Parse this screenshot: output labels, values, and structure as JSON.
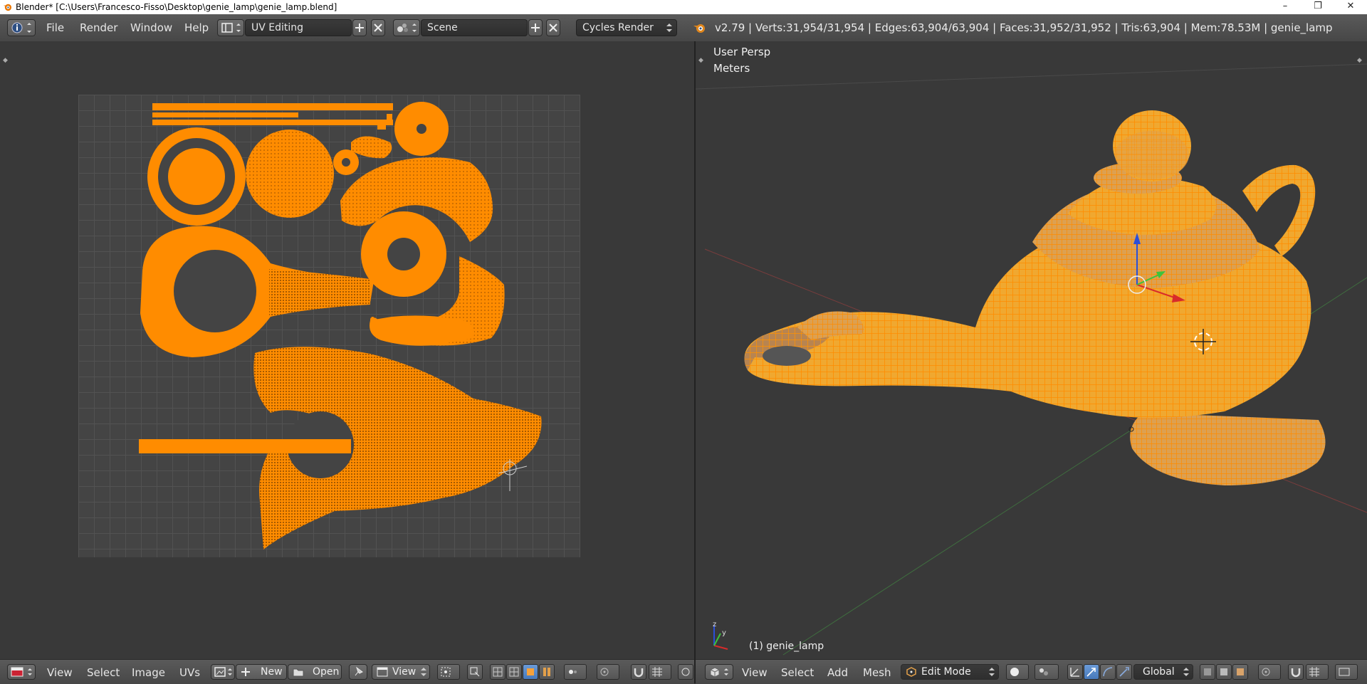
{
  "window": {
    "title": "Blender* [C:\\Users\\Francesco-Fisso\\Desktop\\genie_lamp\\genie_lamp.blend]",
    "min_glyph": "–",
    "restore_glyph": "❐",
    "close_glyph": "✕"
  },
  "infobar": {
    "menus": [
      "File",
      "Render",
      "Window",
      "Help"
    ],
    "screen_layout": "UV Editing",
    "scene": "Scene",
    "render_engine": "Cycles Render",
    "stats": "v2.79 | Verts:31,954/31,954 | Edges:63,904/63,904 | Faces:31,952/31,952 | Tris:63,904 | Mem:78.53M | genie_lamp"
  },
  "viewport": {
    "view_name": "User Persp",
    "units": "Meters",
    "object_label": "(1) genie_lamp"
  },
  "uv_footer": {
    "menus": [
      "View",
      "Select",
      "Image",
      "UVs"
    ],
    "new_label": "New",
    "open_label": "Open",
    "view_label": "View"
  },
  "view3d_footer": {
    "menus": [
      "View",
      "Select",
      "Add",
      "Mesh"
    ],
    "mode": "Edit Mode",
    "orientation": "Global"
  },
  "colors": {
    "accent_orange": "#ff8c00",
    "uv_background": "#444444",
    "ui_dark": "#393939"
  },
  "icons": [
    "blender-logo-icon",
    "info-editor-icon",
    "screen-layout-icon",
    "scene-icon",
    "add-icon",
    "close-icon",
    "render-icon",
    "uv-editor-icon",
    "image-icon",
    "pin-icon",
    "mesh-select-icon",
    "3d-view-icon",
    "viewport-shading-icon",
    "pivot-icon",
    "manipulator-icons"
  ]
}
